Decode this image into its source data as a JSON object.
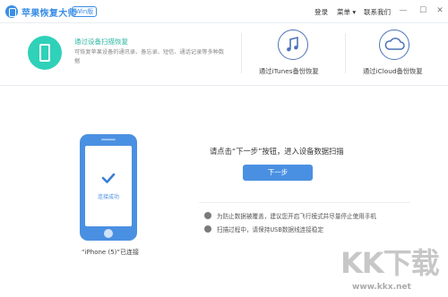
{
  "app": {
    "title": "苹果恢复大师",
    "badge": "Win版",
    "menu": {
      "login": "登录",
      "menu": "菜单 ▾",
      "contact": "联系我们"
    }
  },
  "modes": {
    "device_scan": {
      "title": "通过设备扫描恢复",
      "desc": "可恢复苹果设备的通讯录、备忘录、短信、通话记录等多种数据"
    },
    "itunes": {
      "label": "通过iTunes备份恢复"
    },
    "icloud": {
      "label": "通过iCloud备份恢复"
    }
  },
  "main": {
    "connected": "连接成功",
    "device_name": "“iPhone (5)”已连接",
    "prompt": "请点击“下一步”按钮，进入设备数据扫描",
    "next_button": "下一步",
    "tips": [
      "为防止数据被覆盖，建议您开启飞行模式并尽量停止使用手机",
      "扫描过程中，请保持USB数据线连接稳定"
    ]
  },
  "watermark": {
    "logo": "KK下载",
    "url": "www.kkx.net"
  },
  "colors": {
    "accent": "#4a90e2",
    "teal": "#2fd1b8"
  },
  "icons": {
    "logo": "app-logo-icon",
    "device": "phone-icon",
    "itunes": "music-note-icon",
    "icloud": "cloud-icon"
  }
}
